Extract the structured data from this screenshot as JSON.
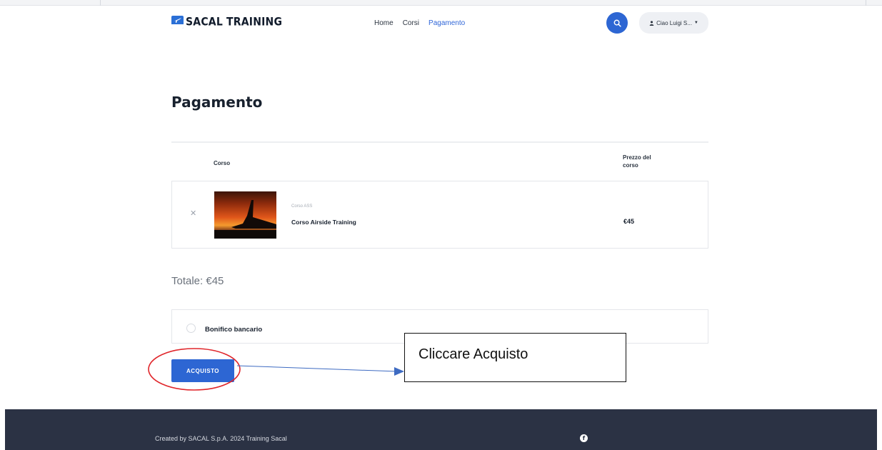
{
  "header": {
    "logo_text": "SACAL TRAINING",
    "logo_badge_text": "SACAL",
    "nav": [
      "Home",
      "Corsi",
      "Pagamento"
    ],
    "active_nav": "Pagamento",
    "user_label": "Ciao Luigi S...",
    "search_icon": "search-icon",
    "user_icon": "user-icon",
    "caret_icon": "caret-down-icon"
  },
  "page": {
    "title": "Pagamento"
  },
  "table": {
    "col_course": "Corso",
    "col_price": "Prezzo del corso",
    "rows": [
      {
        "category": "Corso ASS",
        "name": "Corso Airside Training",
        "price": "€45",
        "remove_icon": "close-icon"
      }
    ]
  },
  "total": "Totale: €45",
  "payment": {
    "option_label": "Bonifico bancario",
    "selected": false
  },
  "buy_button": "ACQUISTO",
  "annotation": {
    "callout_text": "Cliccare Acquisto",
    "circle_color": "#e0262b",
    "arrow_color": "#3e6bc2"
  },
  "footer": {
    "credit": "Created by SACAL S.p.A. 2024 Training Sacal",
    "social_icon": "facebook-icon"
  },
  "colors": {
    "accent": "#2d66d3",
    "footer_bg": "#2b3244"
  }
}
